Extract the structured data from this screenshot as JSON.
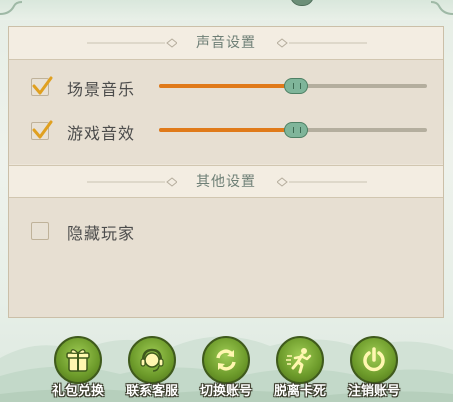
{
  "sound_section": {
    "title": "声音设置",
    "scene_music": {
      "label": "场景音乐",
      "checked": true,
      "level": 0.51
    },
    "game_sfx": {
      "label": "游戏音效",
      "checked": true,
      "level": 0.51
    }
  },
  "other_section": {
    "title": "其他设置",
    "hide_players": {
      "label": "隐藏玩家",
      "checked": false
    }
  },
  "bottom_buttons": [
    {
      "label": "礼包兑换",
      "icon": "gift-icon"
    },
    {
      "label": "联系客服",
      "icon": "headset-icon"
    },
    {
      "label": "切换账号",
      "icon": "switch-icon"
    },
    {
      "label": "脱离卡死",
      "icon": "running-man-icon"
    },
    {
      "label": "注销账号",
      "icon": "power-icon"
    }
  ],
  "colors": {
    "panel_bg": "#ede6da",
    "slider_fill": "#e07a1a",
    "slider_thumb": "#7fb59a",
    "button_green": "#6c9a2a",
    "check_mark": "#e0a020"
  }
}
